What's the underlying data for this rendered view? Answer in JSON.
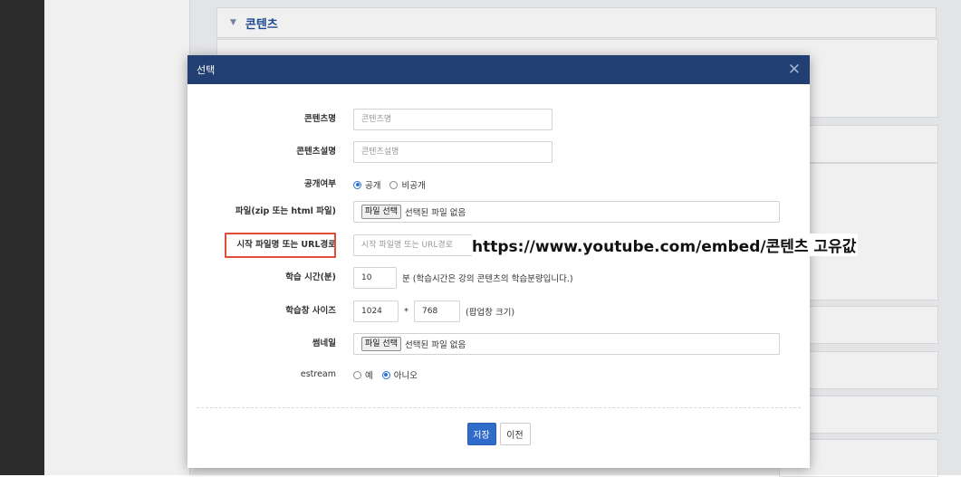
{
  "section": {
    "title": "콘텐츠"
  },
  "modal": {
    "title": "선택",
    "close_icon": "close-icon",
    "fields": {
      "content_name": {
        "label": "콘텐츠명",
        "placeholder": "콘텐츠명",
        "value": ""
      },
      "content_desc": {
        "label": "콘텐츠설명",
        "placeholder": "콘텐츠설명",
        "value": ""
      },
      "visibility": {
        "label": "공개여부",
        "options": [
          "공개",
          "비공개"
        ],
        "selected": "공개"
      },
      "file": {
        "label": "파일(zip 또는 html 파일)",
        "button": "파일 선택",
        "status": "선택된 파일 없음"
      },
      "start_file": {
        "label": "시작 파일명 또는 URL경로",
        "placeholder": "시작 파일명 또는 URL경로",
        "value": ""
      },
      "study_time": {
        "label": "학습 시간(분)",
        "value": "10",
        "note": "분 (학습시간은 강의 콘텐츠의 학습분량입니다.)"
      },
      "window_size": {
        "label": "학습창 사이즈",
        "width": "1024",
        "separator": "*",
        "height": "768",
        "note": "(팝업창 크기)"
      },
      "thumbnail": {
        "label": "썸네일",
        "button": "파일 선택",
        "status": "선택된 파일 없음"
      },
      "estream": {
        "label": "estream",
        "options": [
          "예",
          "아니오"
        ],
        "selected": "아니오"
      }
    },
    "buttons": {
      "save": "저장",
      "prev": "이전"
    }
  },
  "annotation": {
    "text": "https://www.youtube.com/embed/콘텐츠 고유값"
  },
  "colors": {
    "modal_header": "#213f72",
    "primary": "#2f6bc9",
    "highlight": "#e24d3a"
  }
}
